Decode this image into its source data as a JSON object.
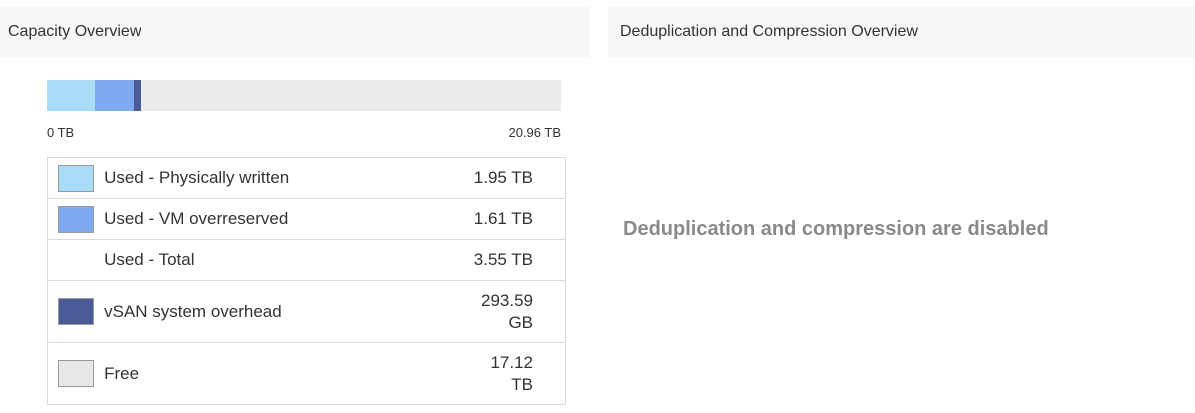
{
  "capacity": {
    "title": "Capacity Overview",
    "axis_min": "0 TB",
    "axis_max": "20.96 TB",
    "bar_segments": [
      {
        "name": "physically-written",
        "fraction": 0.093,
        "color": "#a8dcf7"
      },
      {
        "name": "vm-overreserved",
        "fraction": 0.0768,
        "color": "#7fa9f0"
      },
      {
        "name": "system-overhead",
        "fraction": 0.0137,
        "color": "#4a5b98"
      }
    ],
    "bar_background": "#ebebeb",
    "rows": [
      {
        "label": "Used - Physically written",
        "value": "1.95 TB",
        "swatch_color": "#a8dcf7"
      },
      {
        "label": "Used - VM overreserved",
        "value": "1.61 TB",
        "swatch_color": "#7fa9f0"
      },
      {
        "label": "Used - Total",
        "value": "3.55 TB",
        "swatch_color": ""
      },
      {
        "label": "vSAN system overhead",
        "value": "293.59 GB",
        "swatch_color": "#4a5b98"
      },
      {
        "label": "Free",
        "value": "17.12 TB",
        "swatch_color": "#e8e8e8"
      }
    ]
  },
  "dedup": {
    "title": "Deduplication and Compression Overview",
    "message": "Deduplication and compression are disabled"
  }
}
